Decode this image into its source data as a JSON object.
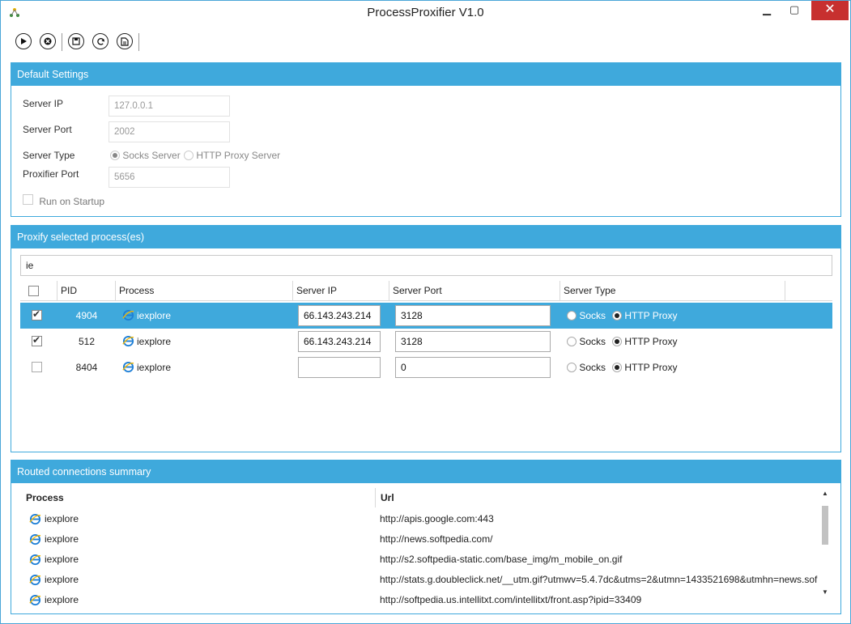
{
  "window": {
    "title": "ProcessProxifier V1.0",
    "minimize": "▁",
    "maximize": "▢",
    "close": "✕"
  },
  "toolbar": {
    "buttons": [
      {
        "name": "play-icon",
        "glyph": "▶"
      },
      {
        "name": "stop-icon",
        "glyph": "✖"
      },
      {
        "name": "save-icon",
        "glyph": "▣"
      },
      {
        "name": "refresh-icon",
        "glyph": "↻"
      },
      {
        "name": "export-icon",
        "glyph": "⎙"
      }
    ]
  },
  "default_settings": {
    "header": "Default Settings",
    "server_ip_label": "Server IP",
    "server_ip_value": "127.0.0.1",
    "server_port_label": "Server Port",
    "server_port_value": "2002",
    "server_type_label": "Server Type",
    "socks_label": "Socks Server",
    "http_label": "HTTP Proxy Server",
    "server_type_selected": "Socks Server",
    "proxifier_port_label": "Proxifier Port",
    "proxifier_port_value": "5656",
    "run_on_startup_label": "Run on Startup",
    "run_on_startup_checked": false
  },
  "proxify": {
    "header": "Proxify selected process(es)",
    "search_value": "ie",
    "columns": {
      "pid": "PID",
      "process": "Process",
      "server_ip": "Server IP",
      "server_port": "Server Port",
      "server_type": "Server Type"
    },
    "rows": [
      {
        "checked": true,
        "pid": "4904",
        "process": "iexplore",
        "server_ip": "66.143.243.214",
        "server_port": "3128",
        "socks": "Socks",
        "http": "HTTP Proxy",
        "selected_type": "HTTP Proxy",
        "row_selected": true
      },
      {
        "checked": true,
        "pid": "512",
        "process": "iexplore",
        "server_ip": "66.143.243.214",
        "server_port": "3128",
        "socks": "Socks",
        "http": "HTTP Proxy",
        "selected_type": "HTTP Proxy",
        "row_selected": false
      },
      {
        "checked": false,
        "pid": "8404",
        "process": "iexplore",
        "server_ip": "",
        "server_port": "0",
        "socks": "Socks",
        "http": "HTTP Proxy",
        "selected_type": "HTTP Proxy",
        "row_selected": false
      }
    ]
  },
  "routed": {
    "header": "Routed connections summary",
    "columns": {
      "process": "Process",
      "url": "Url"
    },
    "rows": [
      {
        "process": "iexplore",
        "url": "http://apis.google.com:443"
      },
      {
        "process": "iexplore",
        "url": "http://news.softpedia.com/"
      },
      {
        "process": "iexplore",
        "url": "http://s2.softpedia-static.com/base_img/m_mobile_on.gif"
      },
      {
        "process": "iexplore",
        "url": "http://stats.g.doubleclick.net/__utm.gif?utmwv=5.4.7dc&utms=2&utmn=1433521698&utmhn=news.sof"
      },
      {
        "process": "iexplore",
        "url": "http://softpedia.us.intellitxt.com/intellitxt/front.asp?ipid=33409"
      }
    ],
    "scroll_up": "▲",
    "scroll_down": "▼"
  },
  "colors": {
    "accent": "#3fa9dc",
    "close": "#c7302f"
  }
}
